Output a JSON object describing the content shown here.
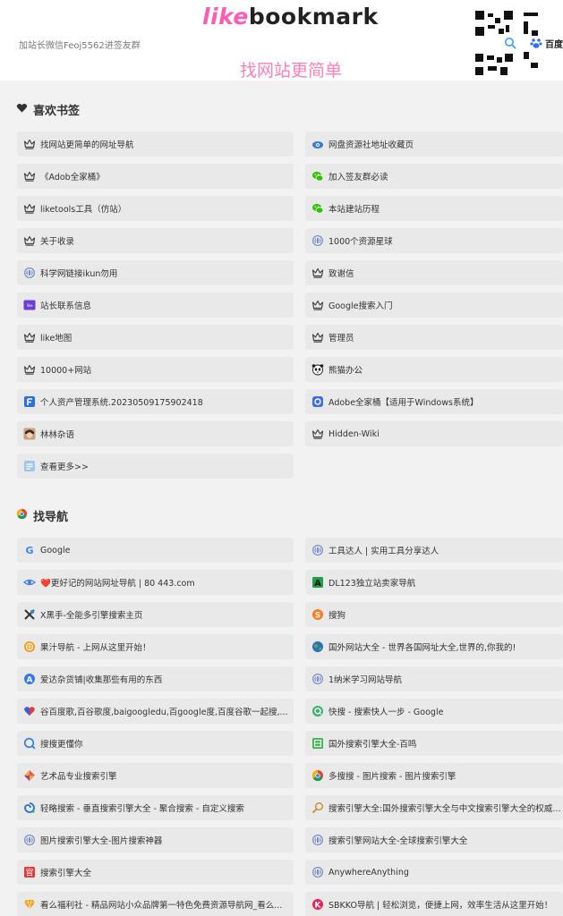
{
  "header": {
    "logo_part1": "like",
    "logo_part2": "bookmark",
    "notice": "加站长微信Feoj5562进签友群",
    "slogan": "找网站更简单",
    "engine_label": "百度"
  },
  "sections": [
    {
      "title": "喜欢书签",
      "icon": "heart-icon",
      "items": [
        {
          "label": "找网站更简单的网址导航",
          "icon": "crown-icon"
        },
        {
          "label": "网盘资源社地址收藏页",
          "icon": "cloud-eye-icon"
        },
        {
          "label": "《Adob全家桶》",
          "icon": "crown-icon"
        },
        {
          "label": "加入签友群必读",
          "icon": "wechat-icon"
        },
        {
          "label": "liketools工具（仿站）",
          "icon": "crown-icon"
        },
        {
          "label": "本站建站历程",
          "icon": "wechat-icon"
        },
        {
          "label": "关于收录",
          "icon": "crown-icon"
        },
        {
          "label": "1000个资源星球",
          "icon": "globe-icon"
        },
        {
          "label": "科学网链接ikun勿用",
          "icon": "globe-icon"
        },
        {
          "label": "致谢信",
          "icon": "crown-icon"
        },
        {
          "label": "站长联系信息",
          "icon": "purple-card-icon"
        },
        {
          "label": "Google搜索入门",
          "icon": "crown-icon"
        },
        {
          "label": "like地图",
          "icon": "crown-icon"
        },
        {
          "label": "管理员",
          "icon": "crown-icon"
        },
        {
          "label": "10000+网站",
          "icon": "crown-icon"
        },
        {
          "label": "熊猫办公",
          "icon": "panda-icon"
        },
        {
          "label": "个人资产管理系统.20230509175902418",
          "icon": "blue-f-icon"
        },
        {
          "label": "Adobe全家桶【适用于Windows系统】",
          "icon": "blue-square-icon"
        },
        {
          "label": "林林杂语",
          "icon": "avatar-icon"
        },
        {
          "label": "Hidden-Wiki",
          "icon": "crown-icon"
        },
        {
          "label": "查看更多>>",
          "icon": "more-icon"
        }
      ]
    },
    {
      "title": "找导航",
      "icon": "chrome-icon",
      "items": [
        {
          "label": "Google",
          "icon": "google-icon"
        },
        {
          "label": "工具达人 | 实用工具分享达人",
          "icon": "globe-icon"
        },
        {
          "label": "❤️更好记的网站网址导航 | 80 443.com",
          "icon": "eye-icon"
        },
        {
          "label": "DL123独立站卖家导航",
          "icon": "green-a-icon"
        },
        {
          "label": "X黑手-全能多引擎搜索主页",
          "icon": "x-hand-icon"
        },
        {
          "label": "搜狗",
          "icon": "sogou-icon"
        },
        {
          "label": "果汁导航 - 上网从这里开始！",
          "icon": "orange-icon"
        },
        {
          "label": "国外网站大全 - 世界各国网址大全,世界的,你我的!",
          "icon": "earth-icon"
        },
        {
          "label": "爱达杂货铺|收集那些有用的东西",
          "icon": "blue-a-icon"
        },
        {
          "label": "1纳米学习网站导航",
          "icon": "globe-icon"
        },
        {
          "label": "谷百度歌,百谷歌度,baigoogledu,百google度,百度谷歌一起搜,...",
          "icon": "heart-multi-icon"
        },
        {
          "label": "快搜 - 搜索快人一步 - Google",
          "icon": "green-q-icon"
        },
        {
          "label": "搜搜更懂你",
          "icon": "q-search-icon"
        },
        {
          "label": "国外搜索引擎大全-百鸣",
          "icon": "green-box-icon"
        },
        {
          "label": "艺术品专业搜索引擎",
          "icon": "art-icon"
        },
        {
          "label": "多搜搜 - 图片搜索 - 图片搜索引擎",
          "icon": "chrome-icon"
        },
        {
          "label": "轻略搜索 - 垂直搜索引擎大全 - 聚合搜索 - 自定义搜索",
          "icon": "swirl-icon"
        },
        {
          "label": "搜索引擎大全:国外搜索引擎大全与中文搜索引擎大全的权威收录",
          "icon": "magnify-icon"
        },
        {
          "label": "图片搜索引擎大全-图片搜索神器",
          "icon": "globe-icon"
        },
        {
          "label": "搜索引擎网站大全-全球搜索引擎大全",
          "icon": "globe-icon"
        },
        {
          "label": "搜索引擎大全",
          "icon": "red-guan-icon"
        },
        {
          "label": "AnywhereAnything",
          "icon": "globe-icon"
        },
        {
          "label": "看么福利社 - 精品网站小众品牌第一特色免费资源导航网_看么...",
          "icon": "gem-icon"
        },
        {
          "label": "SBKKO导航 | 轻松浏览，便捷上网，效率生活从这里开始！",
          "icon": "red-k-icon"
        }
      ]
    }
  ]
}
